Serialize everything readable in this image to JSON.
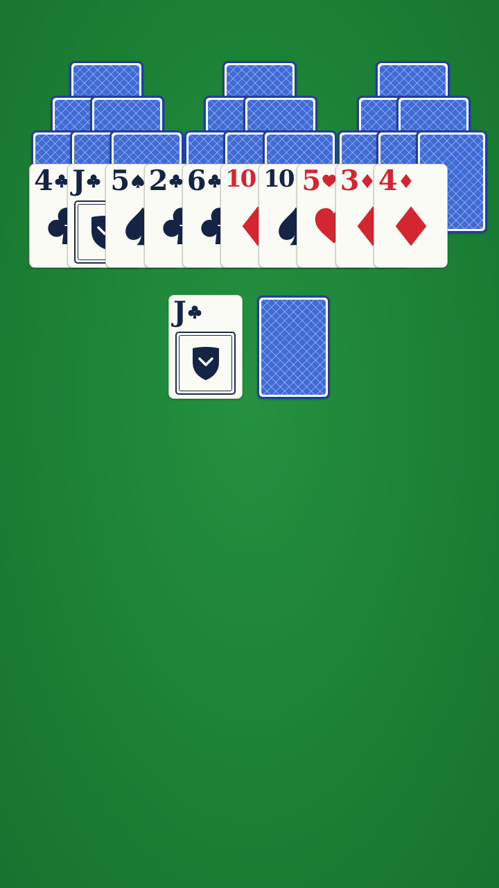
{
  "game": "TriPeaks Solitaire",
  "colors": {
    "felt": "#1f8a3b",
    "card_back_border": "#1e3f9c",
    "card_back_fill": "#3f6bd6",
    "card_face": "#fbfbf6",
    "black_suit": "#152445",
    "red_suit": "#d32630"
  },
  "peaks": {
    "row1_face_down": 3,
    "row2_face_down": 6,
    "row3_face_down": 9
  },
  "bottom_row": [
    {
      "rank": "4",
      "suit": "clubs",
      "color": "black"
    },
    {
      "rank": "J",
      "suit": "clubs",
      "color": "black"
    },
    {
      "rank": "5",
      "suit": "spades",
      "color": "black"
    },
    {
      "rank": "2",
      "suit": "clubs",
      "color": "black"
    },
    {
      "rank": "6",
      "suit": "clubs",
      "color": "black"
    },
    {
      "rank": "10",
      "suit": "diamonds",
      "color": "red"
    },
    {
      "rank": "10",
      "suit": "spades",
      "color": "black"
    },
    {
      "rank": "5",
      "suit": "hearts",
      "color": "red"
    },
    {
      "rank": "3",
      "suit": "diamonds",
      "color": "red"
    },
    {
      "rank": "4",
      "suit": "diamonds",
      "color": "red"
    }
  ],
  "waste": {
    "rank": "J",
    "suit": "clubs",
    "color": "black"
  },
  "stock": {
    "face_down": true
  },
  "icons": {
    "jack_emblem": "shield-chevron-icon",
    "card_back": "crosshatch-pattern"
  }
}
